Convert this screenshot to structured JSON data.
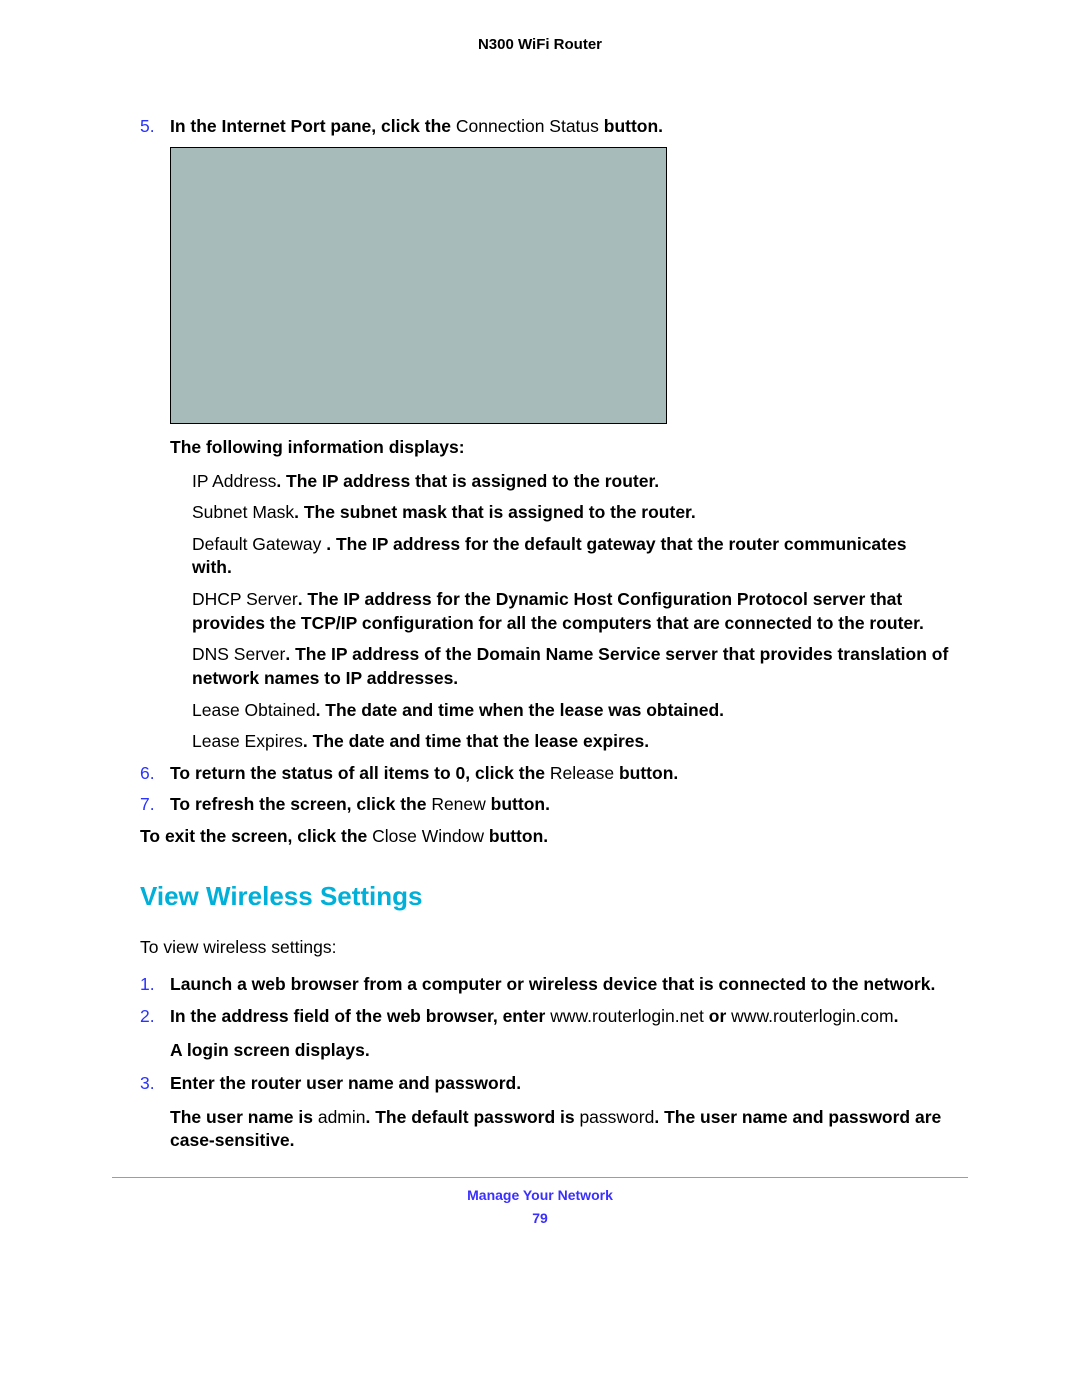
{
  "header": {
    "title": "N300 WiFi Router"
  },
  "steps_a": {
    "s5": {
      "num": "5.",
      "t1": "In the Internet Port pane, click the ",
      "t2": "Connection Status ",
      "t3": "button."
    },
    "info_displays": "The following information displays:",
    "bullets": {
      "ip": {
        "term": "IP Address",
        "desc": ". The IP address that is assigned to the router."
      },
      "mask": {
        "term": "Subnet Mask",
        "desc": ". The subnet mask that is assigned to the router."
      },
      "gateway": {
        "term": "Default Gateway ",
        "desc": ". The IP address for the default gateway that the router communicates with."
      },
      "dhcp": {
        "term": "DHCP Server",
        "desc": ". The IP address for the Dynamic Host Configuration Protocol server that provides the TCP/IP configuration for all the computers that are connected to the router."
      },
      "dns": {
        "term": "DNS Server",
        "desc": ". The IP address of the Domain Name Service server that provides translation of network names to IP addresses."
      },
      "lease_obt": {
        "term": "Lease Obtained",
        "desc": ". The date and time when the lease was obtained."
      },
      "lease_exp": {
        "term": "Lease Expires",
        "desc": ". The date and time that the lease expires."
      }
    },
    "s6": {
      "num": "6.",
      "t1": "To return the status of all items to 0, click the ",
      "t2": "Release ",
      "t3": "button."
    },
    "s7": {
      "num": "7.",
      "t1": "To refresh the screen, click the ",
      "t2": "Renew ",
      "t3": "button."
    },
    "exit": {
      "t1": "To exit the screen, click the ",
      "t2": "Close Window ",
      "t3": "button."
    }
  },
  "section_heading": "View Wireless Settings",
  "intro": "To view wireless settings:",
  "steps_b": {
    "s1": {
      "num": "1.",
      "text": "Launch a web browser from a computer or wireless device that is connected to the network."
    },
    "s2": {
      "num": "2.",
      "t1": "In the address field of the web browser, ",
      "t2": "enter ",
      "t3": "www.routerlogin.net ",
      "t4": "or ",
      "t5": "www.routerlogin.com",
      "t6": ".",
      "note": "A login screen displays."
    },
    "s3": {
      "num": "3.",
      "t1": "Enter the router ",
      "t2": "user name and password.",
      "n1": "The user name is ",
      "n2": "admin",
      "n3": ". The default password is ",
      "n4": "password",
      "n5": ". The user name and password are case-sensitive."
    }
  },
  "footer": {
    "chapter": "Manage Your Network",
    "page": "79"
  }
}
